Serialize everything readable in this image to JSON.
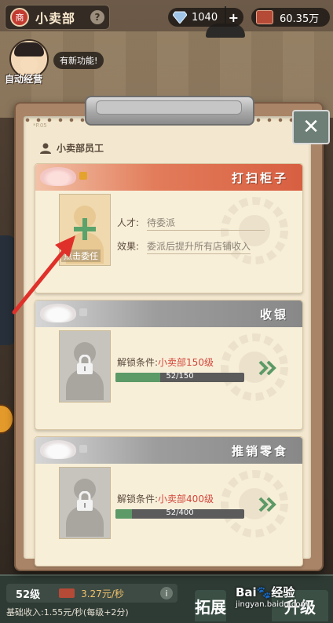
{
  "topbar": {
    "shop_badge": "商",
    "title": "小卖部",
    "help_icon": "?",
    "gems": "1040",
    "gem_plus": "+",
    "money": "60.35万"
  },
  "auto_manage": {
    "label": "自动经营",
    "new_feature": "有新功能!"
  },
  "dialog": {
    "page_no": "*P.05",
    "section_title": "小卖部员工",
    "close_label": "✕",
    "cards": [
      {
        "title": "打扫柜子",
        "state": "active",
        "talent_label": "人才:",
        "talent_value": "待委派",
        "effect_label": "效果:",
        "effect_value": "委派后提升所有店铺收入",
        "appoint_label": "点击委任"
      },
      {
        "title": "收银",
        "state": "locked",
        "unlock_label": "解锁条件:",
        "unlock_value": "小卖部150级",
        "progress_text": "52/150",
        "progress_fraction": 0.3467
      },
      {
        "title": "推销零食",
        "state": "locked",
        "unlock_label": "解锁条件:",
        "unlock_value": "小卖部400级",
        "progress_text": "52/400",
        "progress_fraction": 0.13
      }
    ]
  },
  "bottom": {
    "level": "52级",
    "income_rate": "3.27元/秒",
    "info_icon": "i",
    "base_income": "基础收入:1.55元/秒(每级+2分)",
    "expand_label": "拓展",
    "upgrade_label": "升级"
  },
  "watermark": {
    "brand": "Bai",
    "brand_cn": "经验",
    "url": "jingyan.baidu.com"
  },
  "colors": {
    "active_header": "#d85f41",
    "locked_header": "#888888",
    "progress_fill": "#5c9a67",
    "unlock_value": "#d2473b",
    "annotation_arrow": "#e0302a"
  }
}
